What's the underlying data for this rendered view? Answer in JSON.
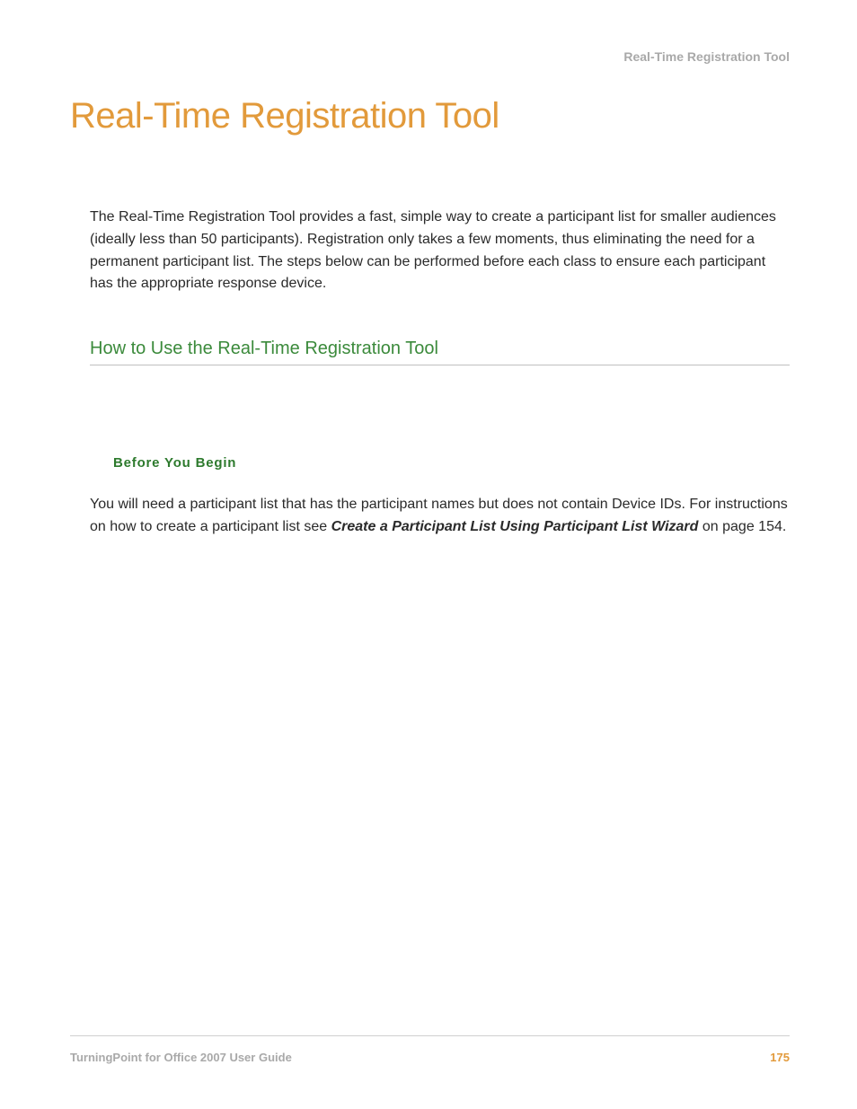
{
  "header": {
    "running_head": "Real-Time Registration Tool"
  },
  "title": "Real-Time Registration Tool",
  "intro": "The Real-Time Registration Tool provides a fast, simple way to create a participant list for smaller audiences (ideally less than 50 participants). Registration only takes a few moments, thus eliminating the need for a permanent participant list. The steps below can be performed before each class to ensure each participant has the appropriate response device.",
  "section": {
    "heading": "How to Use the Real-Time Registration Tool"
  },
  "before_you_begin": {
    "label": "Before You Begin",
    "text_part1": "You will need a participant list that has the participant names but does not contain Device IDs. For instructions on how to create a participant list see ",
    "link_text": "Create a Participant List Using Participant List Wizard",
    "text_part2": " on page 154."
  },
  "footer": {
    "guide_name": "TurningPoint for Office 2007 User Guide",
    "page_number": "175"
  }
}
